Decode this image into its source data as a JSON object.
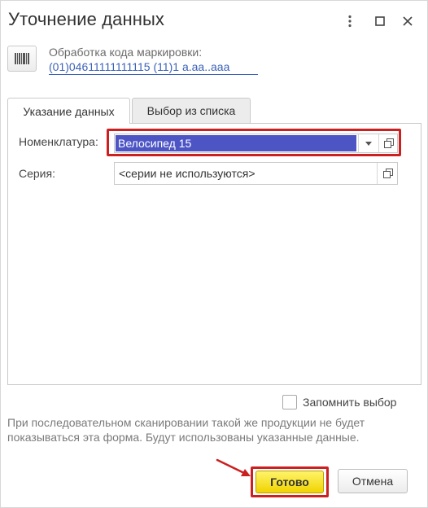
{
  "window": {
    "title": "Уточнение данных"
  },
  "titlebar_buttons": {
    "more_icon": "vertical-dots-icon",
    "maximize_icon": "maximize-icon",
    "close_icon": "close-icon"
  },
  "info": {
    "barcode_icon": "barcode-icon",
    "label": "Обработка кода маркировки:",
    "code": "(01)04611111111115 (11)1   a.aa..aaa"
  },
  "tabs": [
    {
      "label": "Указание данных",
      "active": true
    },
    {
      "label": "Выбор из списка",
      "active": false
    }
  ],
  "form": {
    "nomenclature": {
      "label": "Номенклатура:",
      "value": "Велосипед 15",
      "dropdown_icon": "chevron-down-icon",
      "open_icon": "open-copy-icon"
    },
    "series": {
      "label": "Серия:",
      "value": "<серии не используются>",
      "open_icon": "open-copy-icon"
    }
  },
  "remember": {
    "label": "Запомнить выбор",
    "checked": false
  },
  "hint": "При последовательном сканировании такой же продукции не будет показываться эта форма. Будут использованы указанные данные.",
  "buttons": {
    "ok": "Готово",
    "cancel": "Отмена"
  },
  "colors": {
    "highlight_red": "#cc1f1f",
    "selection_blue": "#4d55c5",
    "link_blue": "#3b62b9",
    "ok_yellow": "#f0d300"
  }
}
